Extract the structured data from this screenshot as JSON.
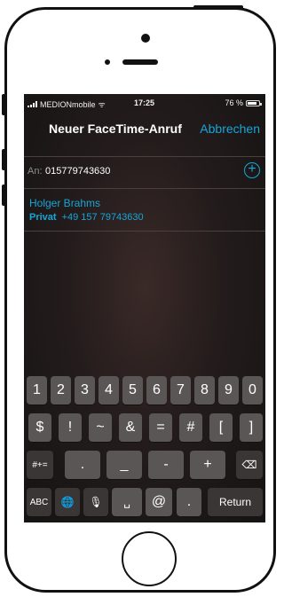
{
  "status": {
    "carrier": "MEDIONmobile",
    "time": "17:25",
    "battery": "76 %"
  },
  "nav": {
    "title": "Neuer FaceTime-Anruf",
    "cancel": "Abbrechen"
  },
  "recipient": {
    "label": "An:",
    "value": "015779743630"
  },
  "suggestion": {
    "name": "Holger Brahms",
    "type": "Privat",
    "number": "+49 157 79743630"
  },
  "keyboard": {
    "row1": [
      "1",
      "2",
      "3",
      "4",
      "5",
      "6",
      "7",
      "8",
      "9",
      "0"
    ],
    "row2": [
      "$",
      "!",
      "~",
      "&",
      "=",
      "#",
      "[",
      "]"
    ],
    "row3": {
      "shift": "#+=",
      "keys": [
        ".",
        "_",
        "-",
        "+"
      ],
      "delete": "⌫"
    },
    "row4": {
      "abc": "ABC",
      "globe": "🌐",
      "mic": "🎙",
      "space": "␣",
      "at": "@",
      "dot": ".",
      "return": "Return"
    }
  },
  "colors": {
    "accent": "#16a6d9",
    "key": "#5b5656",
    "key_dark": "#3a3636"
  }
}
